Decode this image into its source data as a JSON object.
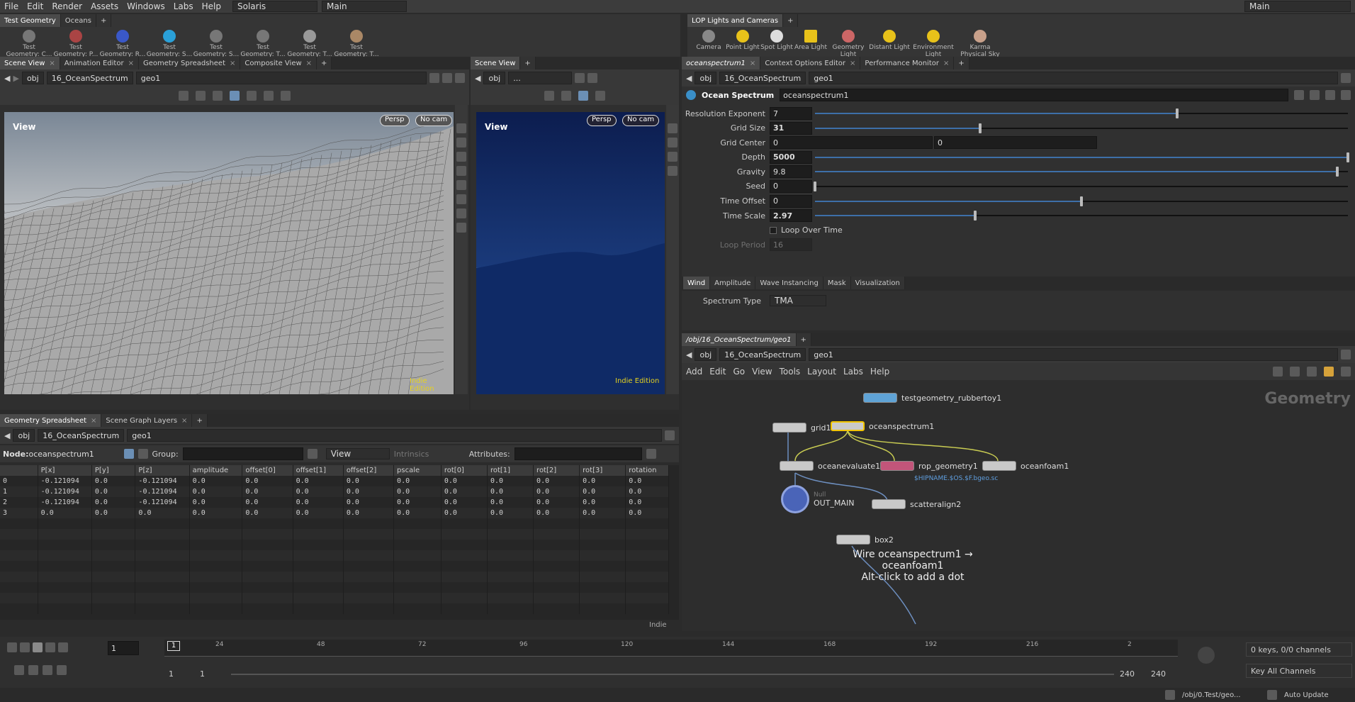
{
  "menu": {
    "items": [
      "File",
      "Edit",
      "Render",
      "Assets",
      "Windows",
      "Labs",
      "Help"
    ],
    "desktop": "Solaris",
    "context": "Main",
    "right_desktop": "Main"
  },
  "shelf_left": {
    "tabs": [
      "Test Geometry",
      "Oceans"
    ],
    "tools": [
      "Test Geometry: C...",
      "Test Geometry: P...",
      "Test Geometry: R...",
      "Test Geometry: S...",
      "Test Geometry: S...",
      "Test Geometry: T...",
      "Test Geometry: T...",
      "Test Geometry: T..."
    ]
  },
  "shelf_right": {
    "tabs": [
      "LOP Lights and Cameras"
    ],
    "tools": [
      "Camera",
      "Point Light",
      "Spot Light",
      "Area Light",
      "Geometry Light",
      "Distant Light",
      "Environment Light",
      "Karma Physical Sky"
    ]
  },
  "left_pane": {
    "tabs": [
      "Scene View",
      "Animation Editor",
      "Geometry Spreadsheet",
      "Composite View"
    ],
    "path": [
      "obj",
      "16_OceanSpectrum",
      "geo1"
    ],
    "view_label": "View",
    "persp": "Persp",
    "cam": "No cam",
    "edition": "Indie Edition"
  },
  "middle_pane": {
    "tabs": [
      "Scene View"
    ],
    "path": [
      "obj",
      "..."
    ],
    "view_label": "View",
    "persp": "Persp",
    "cam": "No cam",
    "edition": "Indie Edition"
  },
  "spreadsheet": {
    "tabs": [
      "Geometry Spreadsheet",
      "Scene Graph Layers"
    ],
    "path": [
      "obj",
      "16_OceanSpectrum",
      "geo1"
    ],
    "node_label": "Node:",
    "node": "oceanspectrum1",
    "group_label": "Group:",
    "view": "View",
    "intrinsics": "Intrinsics",
    "attributes_label": "Attributes:",
    "columns": [
      "",
      "P[x]",
      "P[y]",
      "P[z]",
      "amplitude",
      "offset[0]",
      "offset[1]",
      "offset[2]",
      "pscale",
      "rot[0]",
      "rot[1]",
      "rot[2]",
      "rot[3]",
      "rotation"
    ],
    "rows": [
      [
        "0",
        "-0.121094",
        "0.0",
        "-0.121094",
        "0.0",
        "0.0",
        "0.0",
        "0.0",
        "0.0",
        "0.0",
        "0.0",
        "0.0",
        "0.0",
        "0.0"
      ],
      [
        "1",
        "-0.121094",
        "0.0",
        "-0.121094",
        "0.0",
        "0.0",
        "0.0",
        "0.0",
        "0.0",
        "0.0",
        "0.0",
        "0.0",
        "0.0",
        "0.0"
      ],
      [
        "2",
        "-0.121094",
        "0.0",
        "-0.121094",
        "0.0",
        "0.0",
        "0.0",
        "0.0",
        "0.0",
        "0.0",
        "0.0",
        "0.0",
        "0.0",
        "0.0"
      ],
      [
        "3",
        "0.0",
        "0.0",
        "0.0",
        "0.0",
        "0.0",
        "0.0",
        "0.0",
        "0.0",
        "0.0",
        "0.0",
        "0.0",
        "0.0",
        "0.0"
      ]
    ],
    "edition": "Indie"
  },
  "params_pane": {
    "tabs": [
      "oceanspectrum1",
      "Context Options Editor",
      "Performance Monitor"
    ],
    "path": [
      "obj",
      "16_OceanSpectrum",
      "geo1"
    ],
    "node_type": "Ocean Spectrum",
    "node_name": "oceanspectrum1",
    "parms": [
      {
        "label": "Resolution Exponent",
        "value": "7",
        "fraction": 0.68
      },
      {
        "label": "Grid Size",
        "value": "31",
        "fraction": 0.31,
        "bold": true
      },
      {
        "label": "Depth",
        "value": "5000",
        "fraction": 1.0,
        "bold": true
      },
      {
        "label": "Gravity",
        "value": "9.8",
        "fraction": 0.98
      },
      {
        "label": "Seed",
        "value": "0",
        "fraction": 0.0
      },
      {
        "label": "Time Offset",
        "value": "0",
        "fraction": 0.5
      },
      {
        "label": "Time Scale",
        "value": "2.97",
        "fraction": 0.3,
        "bold": true
      }
    ],
    "grid_center_label": "Grid Center",
    "grid_center": [
      "0",
      "0"
    ],
    "loop_label": "Loop Over Time",
    "loop_period_label": "Loop Period",
    "loop_period": "16",
    "sub_tabs": [
      "Wind",
      "Amplitude",
      "Wave Instancing",
      "Mask",
      "Visualization"
    ],
    "spectrum_label": "Spectrum Type",
    "spectrum_value": "TMA"
  },
  "network_pane": {
    "tab": "/obj/16_OceanSpectrum/geo1",
    "path": [
      "obj",
      "16_OceanSpectrum",
      "geo1"
    ],
    "menu": [
      "Add",
      "Edit",
      "Go",
      "View",
      "Tools",
      "Layout",
      "Labs",
      "Help"
    ],
    "context_label": "Geometry",
    "nodes": {
      "rubbertoy": "testgeometry_rubbertoy1",
      "grid": "grid1",
      "spectrum": "oceanspectrum1",
      "evaluate": "oceanevaluate1",
      "rop": "rop_geometry1",
      "rop_path": "$HIPNAME.$OS.$F.bgeo.sc",
      "foam": "oceanfoam1",
      "null_type": "Null",
      "out": "OUT_MAIN",
      "scatter": "scatteralign2",
      "box": "box2"
    },
    "hint_line1": "Wire oceanspectrum1 → oceanfoam1",
    "hint_line2": "Alt-click to add a dot"
  },
  "timeline": {
    "frame": "1",
    "current_marker": "1",
    "ticks": [
      "24",
      "48",
      "72",
      "96",
      "120",
      "144",
      "168",
      "192",
      "216",
      "2"
    ],
    "start": "1",
    "range_start": "1",
    "range_end": "240",
    "end": "240",
    "keys_info": "0 keys, 0/0 channels",
    "key_all": "Key All Channels"
  },
  "status": {
    "path": "/obj/0.Test/geo...",
    "auto_update": "Auto Update"
  },
  "colors": {
    "accent": "#3d6fa8",
    "selected_node": "#f2c500",
    "edition_text": "#e6d21f",
    "wire": "#c9cc52"
  }
}
